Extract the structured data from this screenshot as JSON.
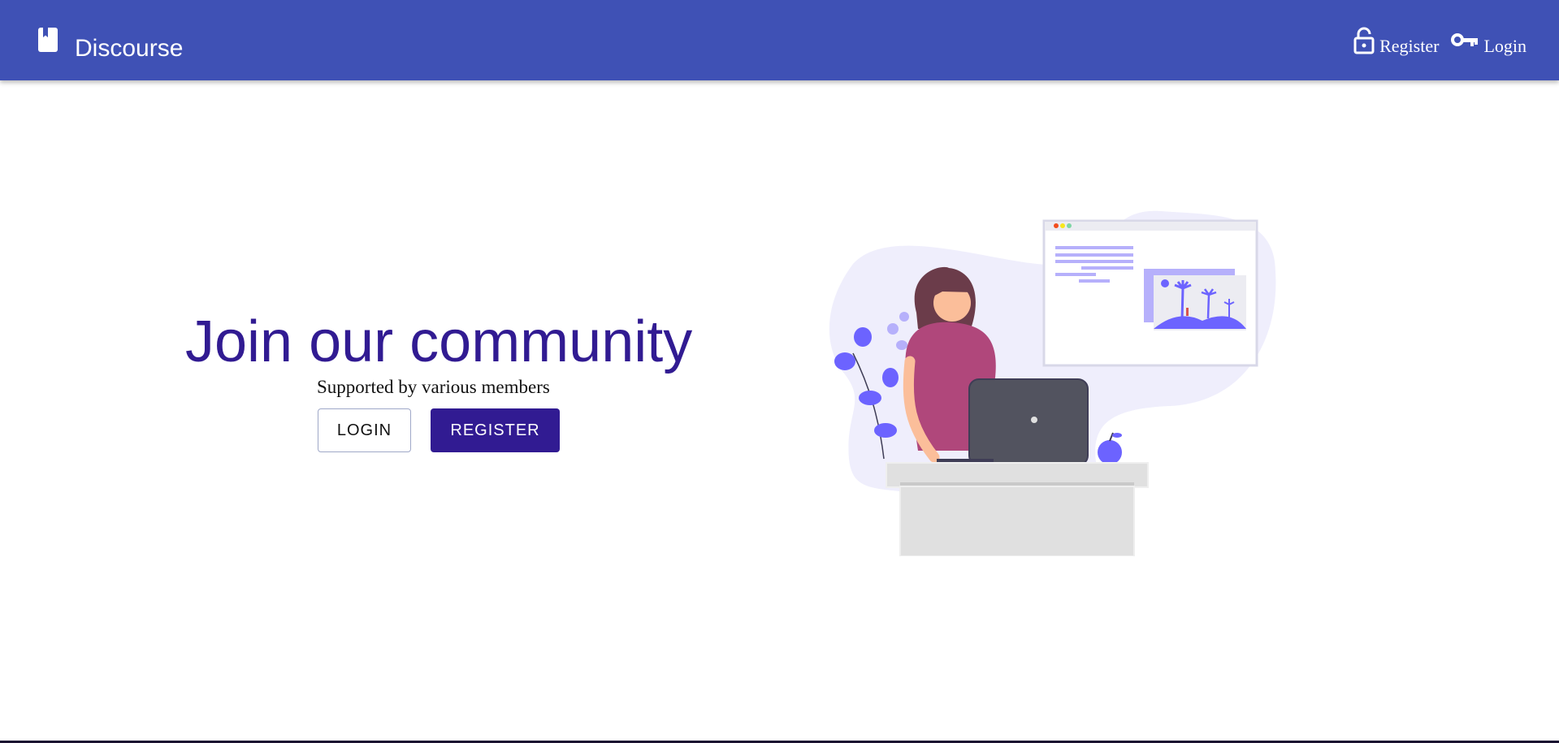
{
  "header": {
    "brand": "Discourse",
    "brand_icon": "bookmark-book-icon",
    "nav": [
      {
        "label": "Register",
        "icon": "lock-open-icon"
      },
      {
        "label": "Login",
        "icon": "key-icon"
      }
    ]
  },
  "hero": {
    "title": "Join our community",
    "subtitle": "Supported by various members",
    "login_label": "LOGIN",
    "register_label": "REGISTER"
  },
  "colors": {
    "appbar": "#3f51b5",
    "accent": "#311b92",
    "illustration_accent": "#6c63ff"
  }
}
